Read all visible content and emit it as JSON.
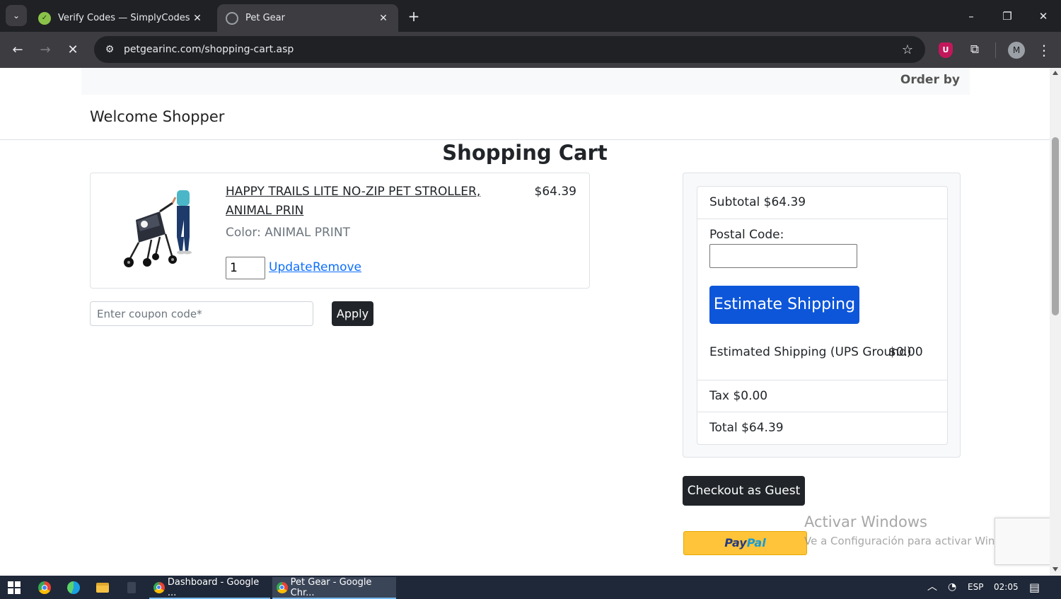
{
  "browser": {
    "tabs": [
      {
        "title": "Verify Codes — SimplyCodes",
        "favicon": "simplycodes-icon"
      },
      {
        "title": "Pet Gear",
        "favicon": "petgear-icon"
      }
    ],
    "url": "petgearinc.com/shopping-cart.asp",
    "profile_initial": "M"
  },
  "header": {
    "order_by": "Order by",
    "welcome": "Welcome Shopper"
  },
  "page": {
    "title": "Shopping Cart"
  },
  "cart": {
    "items": [
      {
        "name": "HAPPY TRAILS LITE NO-ZIP PET STROLLER, ANIMAL PRIN",
        "price": "$64.39",
        "color": "Color: ANIMAL PRINT",
        "quantity": "1",
        "update_label": "Update",
        "remove_label": "Remove"
      }
    ],
    "coupon_placeholder": "Enter coupon code*",
    "apply_label": "Apply"
  },
  "summary": {
    "subtotal": "Subtotal $64.39",
    "postal_label": "Postal Code:",
    "postal_value": "",
    "estimate_label": "Estimate Shipping",
    "estimated_shipping": "Estimated Shipping (UPS Ground)",
    "estimated_shipping_value": "$0.00",
    "tax": "Tax $0.00",
    "total": "Total $64.39"
  },
  "actions": {
    "checkout_guest": "Checkout as Guest",
    "paypal_a": "Pay",
    "paypal_b": "Pal"
  },
  "watermark": {
    "line1": "Activar Windows",
    "line2": "Ve a Configuración para activar Windows."
  },
  "taskbar": {
    "tasks": [
      {
        "label": "Dashboard - Google ..."
      },
      {
        "label": "Pet Gear - Google Chr..."
      }
    ],
    "language": "ESP",
    "time": "02:05"
  },
  "colors": {
    "primary_button": "#0d56d9",
    "dark_button": "#212529",
    "link": "#0d6efd",
    "paypal": "#ffc439"
  }
}
